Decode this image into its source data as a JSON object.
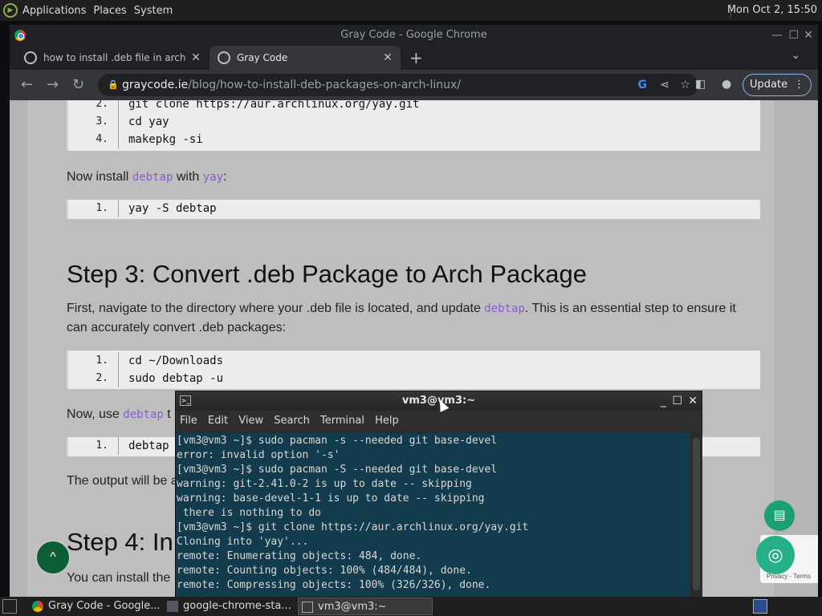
{
  "top_panel": {
    "menus": [
      "Applications",
      "Places",
      "System"
    ],
    "clock": "Mon Oct  2, 15:50"
  },
  "chrome": {
    "window_title": "Gray Code - Google Chrome",
    "tabs": [
      {
        "title": "how to install .deb file in arch l",
        "active": false
      },
      {
        "title": "Gray Code",
        "active": true
      }
    ],
    "url_host": "graycode.ie",
    "url_path": "/blog/how-to-install-deb-packages-on-arch-linux/",
    "update_label": "Update"
  },
  "page": {
    "code1": [
      "git clone https://aur.archlinux.org/yay.git",
      "cd yay",
      "makepkg -si"
    ],
    "code1_nums": [
      "2.",
      "3.",
      "4."
    ],
    "para1_pre": "Now install ",
    "para1_code1": "debtap",
    "para1_mid": " with ",
    "para1_code2": "yay",
    "para1_post": ":",
    "code2": [
      "yay -S debtap"
    ],
    "code2_nums": [
      "1."
    ],
    "heading3": "Step 3: Convert .deb Package to Arch Package",
    "para2_pre": "First, navigate to the directory where your .deb file is located, and update ",
    "para2_code": "debtap",
    "para2_post1": ". This is an essential step to ensure it",
    "para2_post2": "can accurately convert .deb packages:",
    "code3": [
      "cd ~/Downloads",
      "sudo debtap -u"
    ],
    "code3_nums": [
      "1.",
      "2."
    ],
    "para3_pre": "Now, use ",
    "para3_code": "debtap",
    "para3_post": " t",
    "code4": [
      "debtap"
    ],
    "code4_nums": [
      "1."
    ],
    "para4": "The output will be a",
    "heading4": "Step 4: In",
    "para5": "You can install the",
    "scroll_top": "^",
    "recaptcha_label": "Privacy - Terms"
  },
  "terminal": {
    "title": "vm3@vm3:~",
    "menus": [
      "File",
      "Edit",
      "View",
      "Search",
      "Terminal",
      "Help"
    ],
    "lines": [
      "[vm3@vm3 ~]$ sudo pacman -s --needed git base-devel",
      "error: invalid option '-s'",
      "[vm3@vm3 ~]$ sudo pacman -S --needed git base-devel",
      "warning: git-2.41.0-2 is up to date -- skipping",
      "warning: base-devel-1-1 is up to date -- skipping",
      " there is nothing to do",
      "[vm3@vm3 ~]$ git clone https://aur.archlinux.org/yay.git",
      "Cloning into 'yay'...",
      "remote: Enumerating objects: 484, done.",
      "remote: Counting objects: 100% (484/484), done.",
      "remote: Compressing objects: 100% (326/326), done."
    ]
  },
  "taskbar": {
    "tasks": [
      "Gray Code - Google...",
      "google-chrome-sta...",
      "vm3@vm3:~"
    ]
  },
  "colors": {
    "panel_bg": "#1f1f1f",
    "terminal_bg": "#123b4d",
    "accent_green": "#0d5e35",
    "inline_code": "#8a5bd6"
  }
}
